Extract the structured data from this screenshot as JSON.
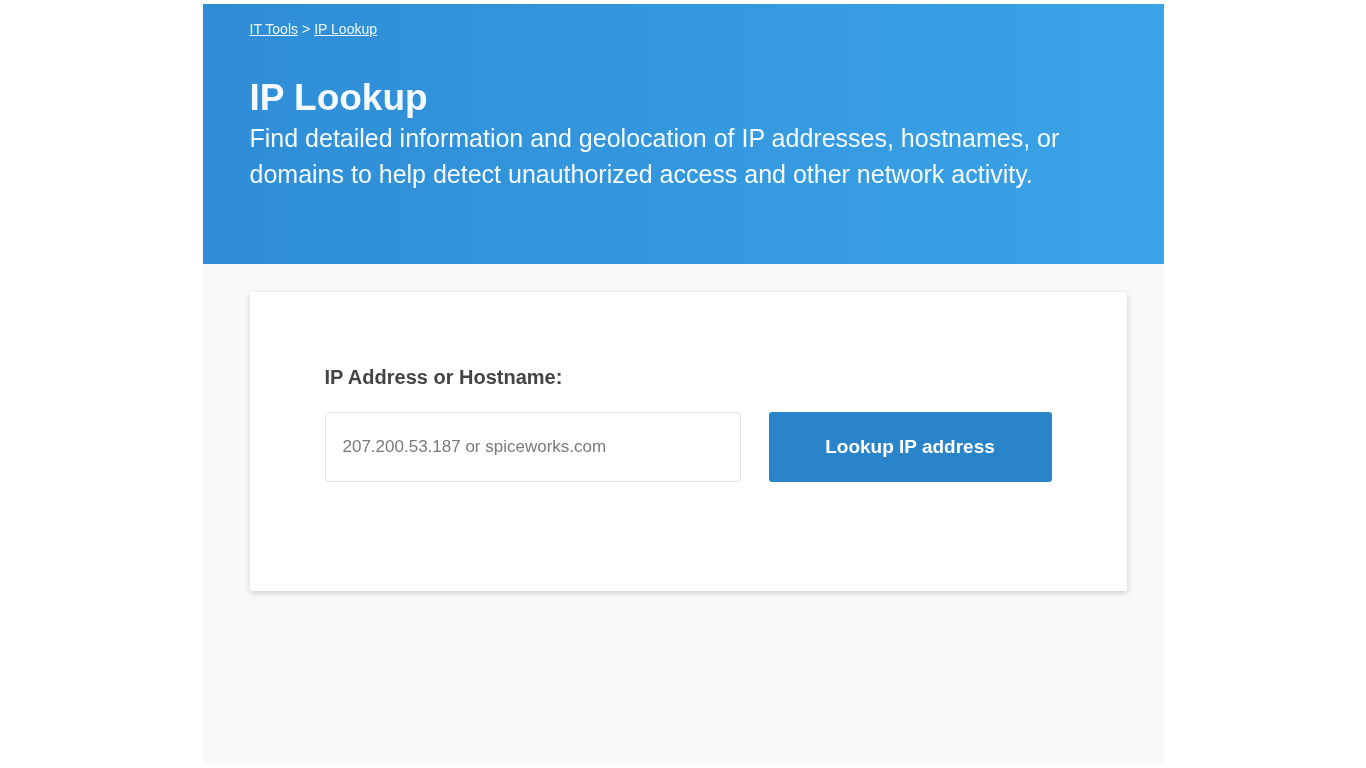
{
  "breadcrumb": {
    "items": [
      "IT Tools",
      "IP Lookup"
    ],
    "separator": ">"
  },
  "header": {
    "title": "IP Lookup",
    "description": "Find detailed information and geolocation of IP addresses, hostnames, or domains to help detect unauthorized access and other network activity."
  },
  "form": {
    "label": "IP Address or Hostname:",
    "input": {
      "placeholder": "207.200.53.187 or spiceworks.com"
    },
    "button": "Lookup IP address"
  }
}
